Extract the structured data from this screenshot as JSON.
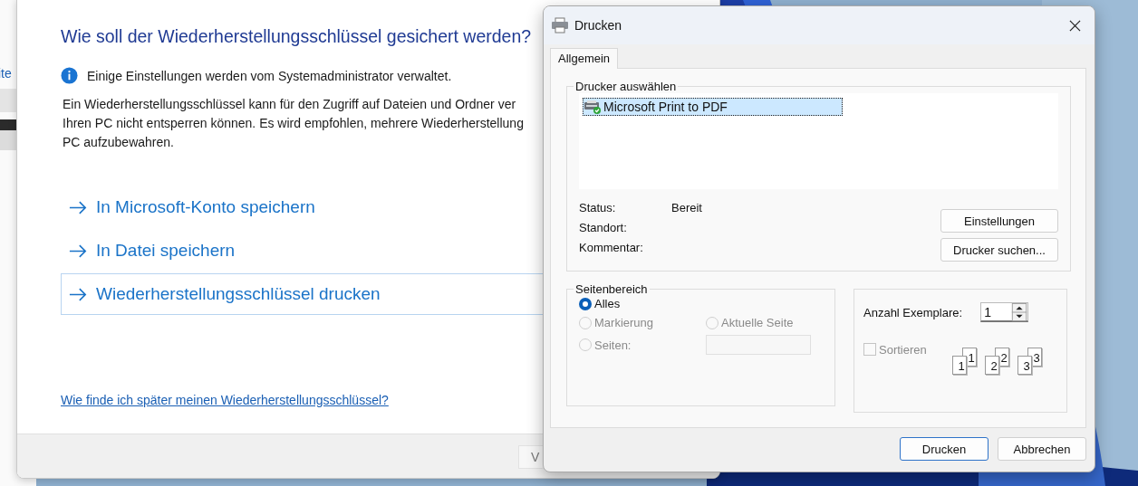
{
  "background_window": {
    "text": "ite"
  },
  "recovery_window": {
    "title": "Wie soll der Wiederherstellungsschlüssel gesichert werden?",
    "notice": "Einige Einstellungen werden vom Systemadministrator verwaltet.",
    "paragraph_lines": [
      "Ein Wiederherstellungsschlüssel kann für den Zugriff auf Dateien und Ordner ver",
      "Ihren PC nicht entsperren können. Es wird empfohlen, mehrere Wiederherstellung",
      "PC aufzubewahren."
    ],
    "options": [
      {
        "label": "In Microsoft-Konto speichern",
        "focused": false
      },
      {
        "label": "In Datei speichern",
        "focused": false
      },
      {
        "label": "Wiederherstellungsschlüssel drucken",
        "focused": true
      }
    ],
    "help_link": "Wie finde ich später meinen Wiederherstellungsschlüssel?",
    "footer_button": "V"
  },
  "print_dialog": {
    "title": "Drucken",
    "tabs": [
      {
        "label": "Allgemein",
        "selected": true
      }
    ],
    "printer_group": {
      "legend": "Drucker auswählen",
      "printers": [
        {
          "name": "Microsoft Print to PDF",
          "selected": true,
          "default": true
        }
      ],
      "fields": [
        {
          "label": "Status:",
          "value": "Bereit"
        },
        {
          "label": "Standort:"
        },
        {
          "label": "Kommentar:"
        }
      ],
      "buttons": [
        "Einstellungen",
        "Drucker suchen..."
      ]
    },
    "page_range": {
      "legend": "Seitenbereich",
      "options": [
        {
          "label": "Alles",
          "selected": true,
          "disabled": false
        },
        {
          "label": "Markierung",
          "selected": false,
          "disabled": true
        },
        {
          "label": "Aktuelle Seite",
          "selected": false,
          "disabled": true
        },
        {
          "label": "Seiten:",
          "selected": false,
          "disabled": true
        }
      ],
      "pages_field": {
        "disabled": true
      }
    },
    "copies": {
      "label": "Anzahl Exemplare:",
      "value": "1",
      "collate": {
        "label": "Sortieren",
        "checked": false,
        "disabled": true
      },
      "collate_pages": [
        {
          "back": "1",
          "front": "1"
        },
        {
          "back": "2",
          "front": "2"
        },
        {
          "back": "3",
          "front": "3"
        }
      ]
    },
    "buttons": [
      {
        "label": "Drucken",
        "default": true
      },
      {
        "label": "Abbrechen",
        "default": false
      }
    ]
  }
}
